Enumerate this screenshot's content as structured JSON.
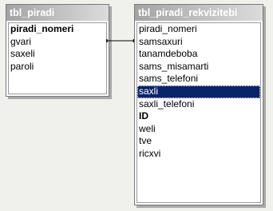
{
  "tables": [
    {
      "title": "tbl_piradi",
      "fields": [
        {
          "name": "piradi_nomeri",
          "key": true,
          "selected": false
        },
        {
          "name": "gvari",
          "key": false,
          "selected": false
        },
        {
          "name": "saxeli",
          "key": false,
          "selected": false
        },
        {
          "name": "paroli",
          "key": false,
          "selected": false
        }
      ]
    },
    {
      "title": "tbl_piradi_rekvizitebi",
      "fields": [
        {
          "name": "piradi_nomeri",
          "key": false,
          "selected": false
        },
        {
          "name": "samsaxuri",
          "key": false,
          "selected": false
        },
        {
          "name": "tanamdeboba",
          "key": false,
          "selected": false
        },
        {
          "name": "sams_misamarti",
          "key": false,
          "selected": false
        },
        {
          "name": "sams_telefoni",
          "key": false,
          "selected": false
        },
        {
          "name": "saxli",
          "key": false,
          "selected": true
        },
        {
          "name": "saxli_telefoni",
          "key": false,
          "selected": false
        },
        {
          "name": "ID",
          "key": true,
          "selected": false
        },
        {
          "name": "weli",
          "key": false,
          "selected": false
        },
        {
          "name": "tve",
          "key": false,
          "selected": false
        },
        {
          "name": "ricxvi",
          "key": false,
          "selected": false
        }
      ]
    }
  ],
  "relationship": {
    "from": "tbl_piradi.piradi_nomeri",
    "to": "tbl_piradi_rekvizitebi.piradi_nomeri"
  },
  "colors": {
    "selection": "#0a246a",
    "title_gradient_start": "#a3a3a3",
    "title_gradient_end": "#dcdcdc",
    "background": "#f0f0ec"
  }
}
